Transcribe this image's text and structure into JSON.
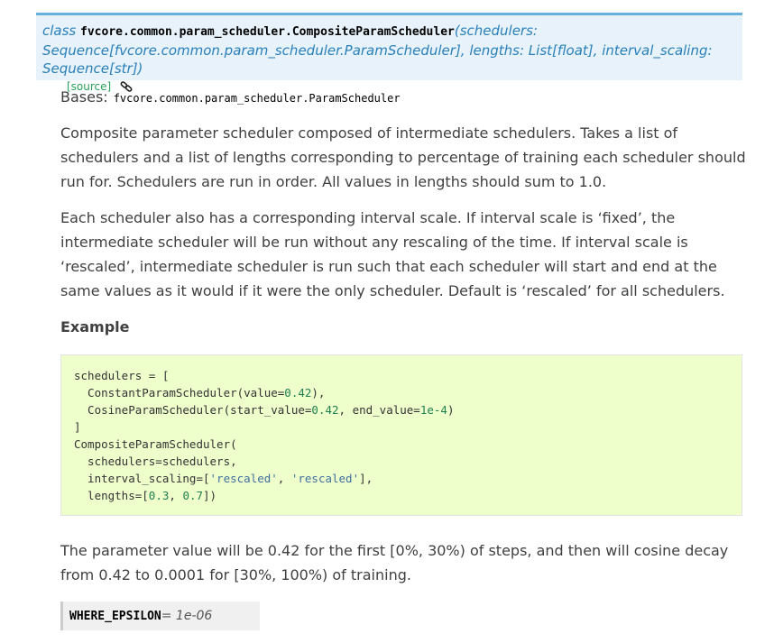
{
  "signature": {
    "keyword": "class",
    "name": "fvcore.common.param_scheduler.CompositeParamScheduler",
    "params_line1": "(schedulers:",
    "params_line2": "Sequence[fvcore.common.param_scheduler.ParamScheduler], lengths: List[float], interval_scaling: Sequence[str])",
    "source_label": "[source]"
  },
  "bases": {
    "label": "Bases:",
    "value": "fvcore.common.param_scheduler.ParamScheduler"
  },
  "description": {
    "p1": "Composite parameter scheduler composed of intermediate schedulers. Takes a list of schedulers and a list of lengths corresponding to percentage of training each scheduler should run for. Schedulers are run in order. All values in lengths should sum to 1.0.",
    "p2": "Each scheduler also has a corresponding interval scale. If interval scale is ‘fixed’, the intermediate scheduler will be run without any rescaling of the time. If interval scale is ‘rescaled’, intermediate scheduler is run such that each scheduler will start and end at the same values as it would if it were the only scheduler. Default is ‘rescaled’ for all schedulers.",
    "example_heading": "Example",
    "p3": "The parameter value will be 0.42 for the first [0%, 30%) of steps, and then will cosine decay from 0.42 to 0.0001 for [30%, 100%) of training."
  },
  "code_lines": [
    [
      "schedulers = [",
      ""
    ],
    [
      "  ConstantParamScheduler(value=",
      "0.42",
      "),"
    ],
    [
      "  CosineParamScheduler(start_value=",
      "0.42",
      ", end_value=",
      "1e-4",
      ")"
    ],
    [
      "]"
    ],
    [
      "CompositeParamScheduler("
    ],
    [
      "  schedulers=schedulers,"
    ],
    [
      "  interval_scaling=[",
      "'rescaled'",
      ", ",
      "'rescaled'",
      "],"
    ],
    [
      "  lengths=[",
      "0.3",
      ", ",
      "0.7",
      "])"
    ]
  ],
  "code_text": {
    "l1": "schedulers = [",
    "l2a": "  ConstantParamScheduler(value=",
    "l2b": "0.42",
    "l2c": "),",
    "l3a": "  CosineParamScheduler(start_value=",
    "l3b": "0.42",
    "l3c": ", end_value=",
    "l3d": "1e-4",
    "l3e": ")",
    "l4": "]",
    "l5": "CompositeParamScheduler(",
    "l6": "  schedulers=schedulers,",
    "l7a": "  interval_scaling=[",
    "l7b": "'rescaled'",
    "l7c": ", ",
    "l7d": "'rescaled'",
    "l7e": "],",
    "l8a": "  lengths=[",
    "l8b": "0.3",
    "l8c": ", ",
    "l8d": "0.7",
    "l8e": "])"
  },
  "attribute": {
    "name": "WHERE_EPSILON",
    "value": "= 1e-06"
  },
  "colors": {
    "signature_bg": "#e7f2fa",
    "signature_border": "#6ab0de",
    "code_bg": "#eeffcc",
    "source_link": "#29a05b"
  }
}
